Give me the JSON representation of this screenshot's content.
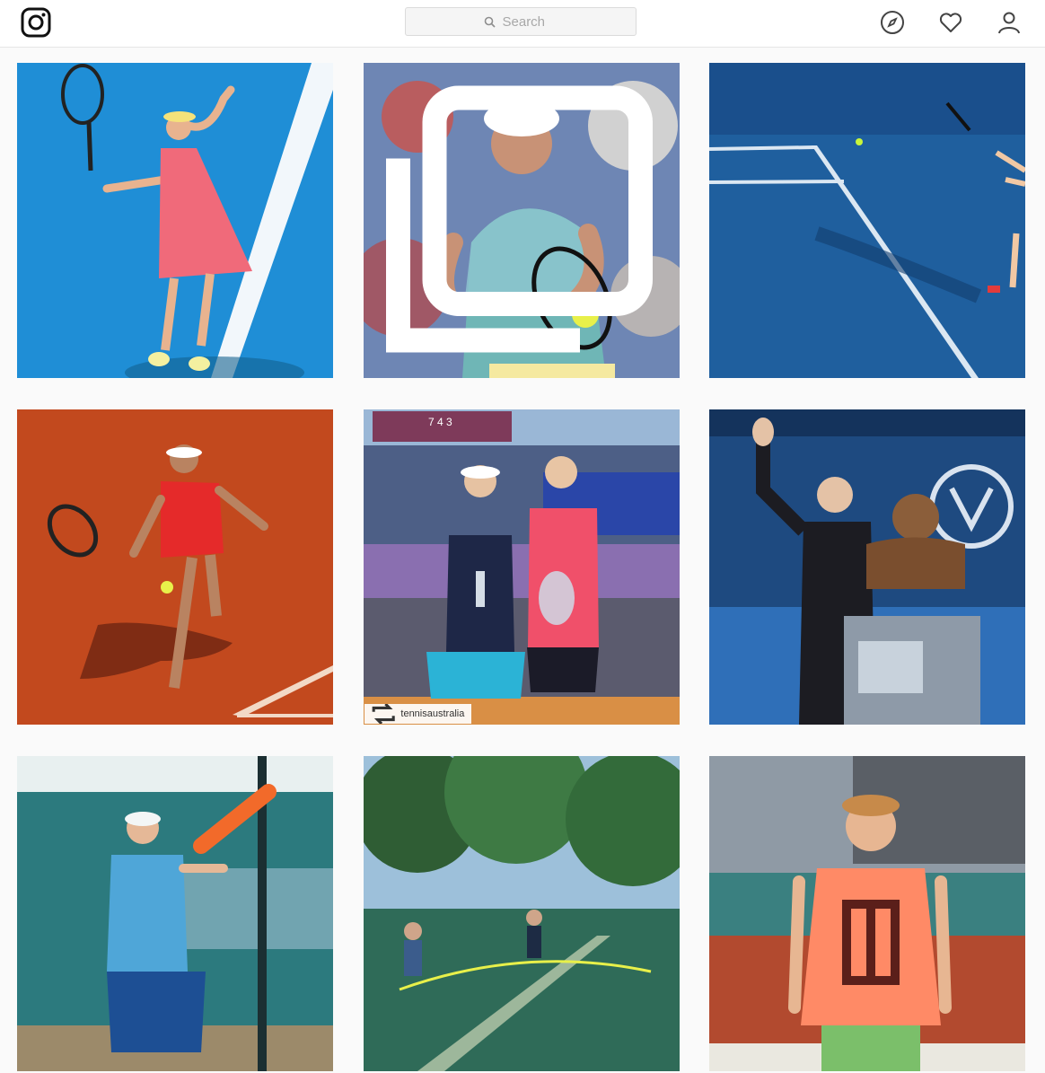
{
  "app": {
    "logo_icon": "instagram-camera-icon"
  },
  "header": {
    "search": {
      "placeholder": "Search",
      "icon": "search-icon"
    },
    "nav_icons": [
      "explore-compass-icon",
      "activity-heart-icon",
      "profile-person-icon"
    ]
  },
  "grid": {
    "posts": [
      {
        "id": "post-1",
        "scene": "serve-blue-court"
      },
      {
        "id": "post-2",
        "scene": "backhand-white-cap",
        "multi": true
      },
      {
        "id": "post-3",
        "scene": "blue-court-lines"
      },
      {
        "id": "post-4",
        "scene": "forehand-clay-court"
      },
      {
        "id": "post-5",
        "scene": "trophy-ceremony",
        "repost_user": "tennisaustralia"
      },
      {
        "id": "post-6",
        "scene": "man-with-bust"
      },
      {
        "id": "post-7",
        "scene": "forehand-fence"
      },
      {
        "id": "post-8",
        "scene": "park-courts-trees"
      },
      {
        "id": "post-9",
        "scene": "boy-orange-shirt"
      }
    ]
  },
  "colors": {
    "court_blue": "#1f8ed6",
    "court_dark_blue": "#1a4f8c",
    "clay": "#c2491e",
    "grass_green": "#2f6b45",
    "pink_dress": "#f06a7a",
    "coral_shirt": "#ff8a66"
  },
  "scoreboard": {
    "text": "7 4 3"
  }
}
